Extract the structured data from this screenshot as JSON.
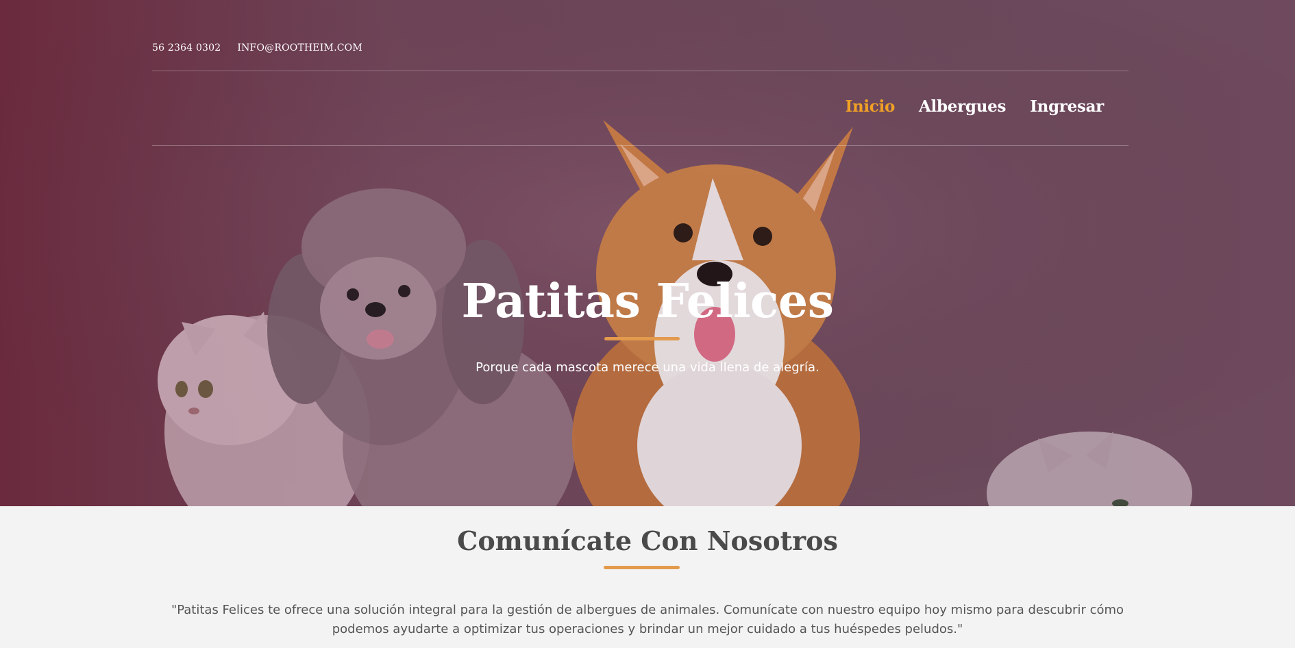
{
  "topbar": {
    "phone": "56 2364 0302",
    "email": "INFO@ROOTHEIM.COM"
  },
  "nav": {
    "items": [
      {
        "label": "Inicio",
        "active": true
      },
      {
        "label": "Albergues",
        "active": false
      },
      {
        "label": "Ingresar",
        "active": false
      }
    ]
  },
  "hero": {
    "title": "Patitas Felices",
    "subtitle": "Porque cada mascota merece una vida llena de alegría."
  },
  "contact": {
    "title": "Comunícate Con Nosotros",
    "text": "\"Patitas Felices te ofrece una solución integral para la gestión de albergues de animales. Comunícate con nuestro equipo hoy mismo para descubrir cómo podemos ayudarte a optimizar tus operaciones y brindar un mejor cuidado a tus huéspedes peludos.\""
  },
  "colors": {
    "accent": "#f0a125",
    "underline": "#e39a4c",
    "hero_overlay": "#6e4558",
    "section_bg": "#f3f3f3"
  }
}
